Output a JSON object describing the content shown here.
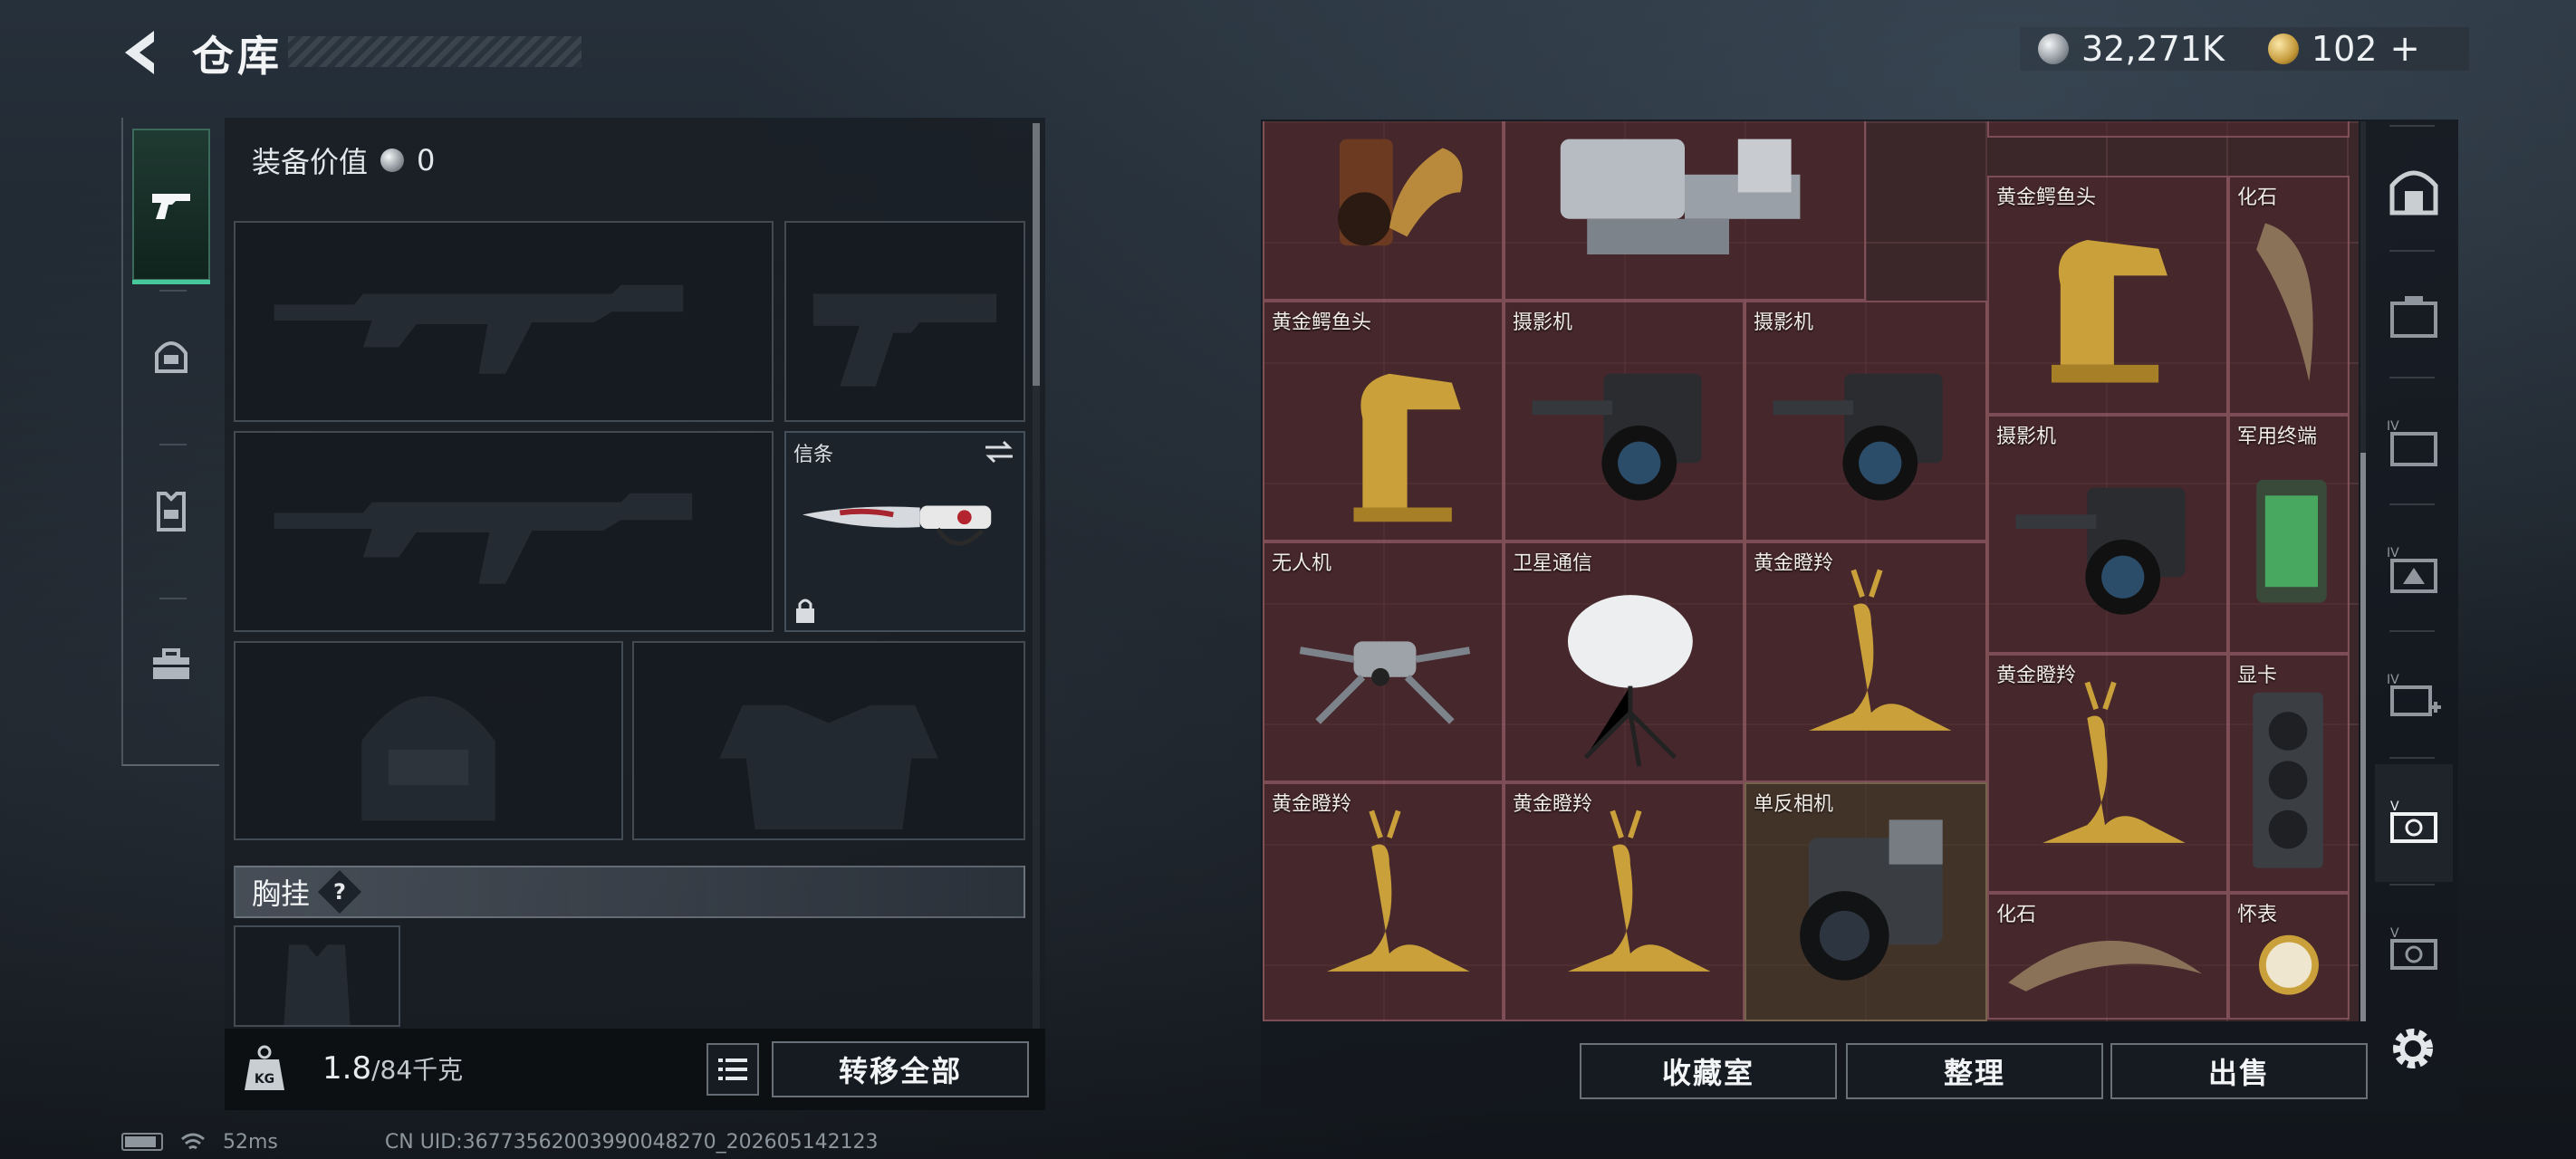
{
  "header": {
    "title": "仓库",
    "currency_silver": "32,271K",
    "currency_gold": "102",
    "gold_plus": "+"
  },
  "left_rail": {
    "items": [
      {
        "icon": "pistol-icon"
      },
      {
        "icon": "helmet-icon"
      },
      {
        "icon": "armor-vest-icon"
      },
      {
        "icon": "toolbox-icon"
      }
    ]
  },
  "loadout": {
    "equip_value_label": "装备价值",
    "equip_value": "0",
    "melee_slot_label": "信条",
    "chest_rig_label": "胸挂",
    "help_symbol": "?",
    "weight_current": "1.8",
    "weight_max": "/84千克",
    "transfer_all": "转移全部"
  },
  "stash": {
    "items": [
      {
        "name": "黄金鳄鱼头"
      },
      {
        "name": "化石"
      },
      {
        "name": "黄金鳄鱼头"
      },
      {
        "name": "摄影机"
      },
      {
        "name": "摄影机"
      },
      {
        "name": "摄影机"
      },
      {
        "name": "军用终端"
      },
      {
        "name": "无人机"
      },
      {
        "name": "卫星通信"
      },
      {
        "name": "黄金瞪羚"
      },
      {
        "name": "黄金瞪羚"
      },
      {
        "name": "显卡"
      },
      {
        "name": "黄金瞪羚"
      },
      {
        "name": "黄金瞪羚"
      },
      {
        "name": "单反相机"
      },
      {
        "name": "化石"
      },
      {
        "name": "怀表"
      }
    ],
    "buttons": {
      "collection": "收藏室",
      "organize": "整理",
      "sell": "出售"
    }
  },
  "right_rail": {
    "items": [
      {
        "icon": "vault-icon"
      },
      {
        "icon": "case-icon"
      },
      {
        "icon": "case-iv-icon"
      },
      {
        "icon": "case-iv-alt-icon"
      },
      {
        "icon": "case-iv-add-icon"
      },
      {
        "icon": "case-v-icon"
      },
      {
        "icon": "case-v-alt-icon"
      }
    ]
  },
  "status": {
    "ping": "52ms",
    "uid": "CN UID:36773562003990048270_202605142123"
  },
  "colors": {
    "accent": "#46c89a",
    "stash_bg": "#3b262a",
    "gold": "#c59a3b"
  }
}
